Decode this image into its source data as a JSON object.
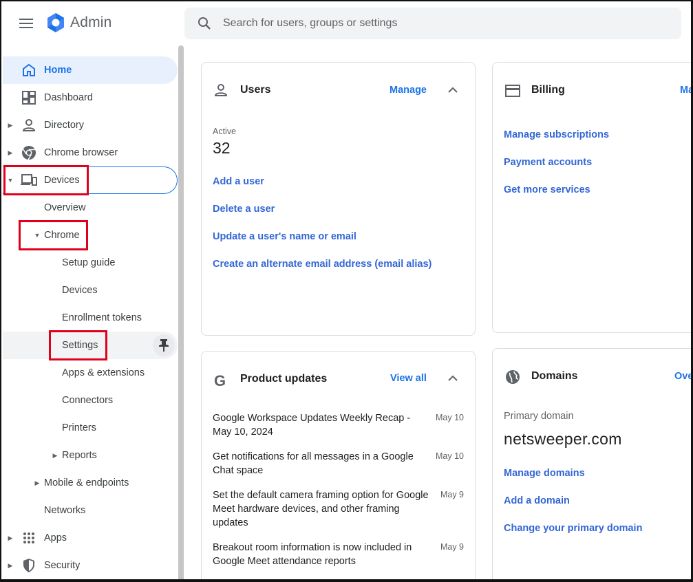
{
  "header": {
    "app_name": "Admin",
    "search_placeholder": "Search for users, groups or settings"
  },
  "sidebar": {
    "home": "Home",
    "dashboard": "Dashboard",
    "directory": "Directory",
    "chrome_browser": "Chrome browser",
    "devices": "Devices",
    "overview": "Overview",
    "chrome": "Chrome",
    "setup_guide": "Setup guide",
    "chrome_devices": "Devices",
    "enrollment_tokens": "Enrollment tokens",
    "settings": "Settings",
    "apps_extensions": "Apps & extensions",
    "connectors": "Connectors",
    "printers": "Printers",
    "reports": "Reports",
    "mobile_endpoints": "Mobile & endpoints",
    "networks": "Networks",
    "apps": "Apps",
    "security": "Security"
  },
  "users_card": {
    "title": "Users",
    "action": "Manage",
    "active_label": "Active",
    "active_count": "32",
    "links": [
      "Add a user",
      "Delete a user",
      "Update a user's name or email",
      "Create an alternate email address (email alias)"
    ]
  },
  "billing_card": {
    "title": "Billing",
    "action": "Ma",
    "links": [
      "Manage subscriptions",
      "Payment accounts",
      "Get more services"
    ]
  },
  "updates_card": {
    "title": "Product updates",
    "action": "View all",
    "items": [
      {
        "text": "Google Workspace Updates Weekly Recap - May 10, 2024",
        "date": "May 10"
      },
      {
        "text": "Get notifications for all messages in a Google Chat space",
        "date": "May 10"
      },
      {
        "text": "Set the default camera framing option for Google Meet hardware devices, and other framing updates",
        "date": "May 9"
      },
      {
        "text": "Breakout room information is now included in Google Meet attendance reports",
        "date": "May 9"
      }
    ]
  },
  "domains_card": {
    "title": "Domains",
    "action": "Ove",
    "primary_label": "Primary domain",
    "primary_domain": "netsweeper.com",
    "links": [
      "Manage domains",
      "Add a domain",
      "Change your primary domain"
    ]
  },
  "colors": {
    "accent": "#1a73e8",
    "link": "#3367d6",
    "highlight_box": "#e0001b",
    "selected_bg": "#e8f0fe"
  }
}
